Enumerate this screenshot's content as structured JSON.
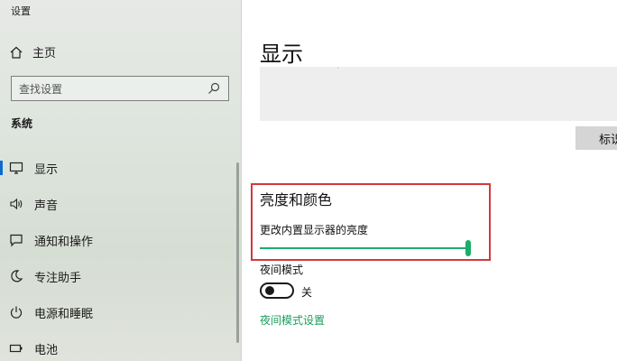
{
  "window": {
    "title": "设置"
  },
  "sidebar": {
    "home_label": "主页",
    "search_placeholder": "查找设置",
    "section_title": "系统",
    "items": [
      {
        "label": "显示",
        "icon": "monitor-icon"
      },
      {
        "label": "声音",
        "icon": "speaker-icon"
      },
      {
        "label": "通知和操作",
        "icon": "notification-icon"
      },
      {
        "label": "专注助手",
        "icon": "moon-icon"
      },
      {
        "label": "电源和睡眠",
        "icon": "power-icon"
      },
      {
        "label": "电池",
        "icon": "battery-icon"
      }
    ],
    "active_index": 0
  },
  "main": {
    "page_title": "显示",
    "identify_button": "标识",
    "brightness": {
      "heading": "亮度和颜色",
      "label": "更改内置显示器的亮度",
      "value_fraction": 0.98
    },
    "night_light": {
      "label": "夜间模式",
      "state": "关",
      "link": "夜间模式设置"
    }
  },
  "colors": {
    "accent_green": "#1cad6b",
    "highlight_red": "#d23a3a",
    "link_green": "#1a9e5c"
  }
}
